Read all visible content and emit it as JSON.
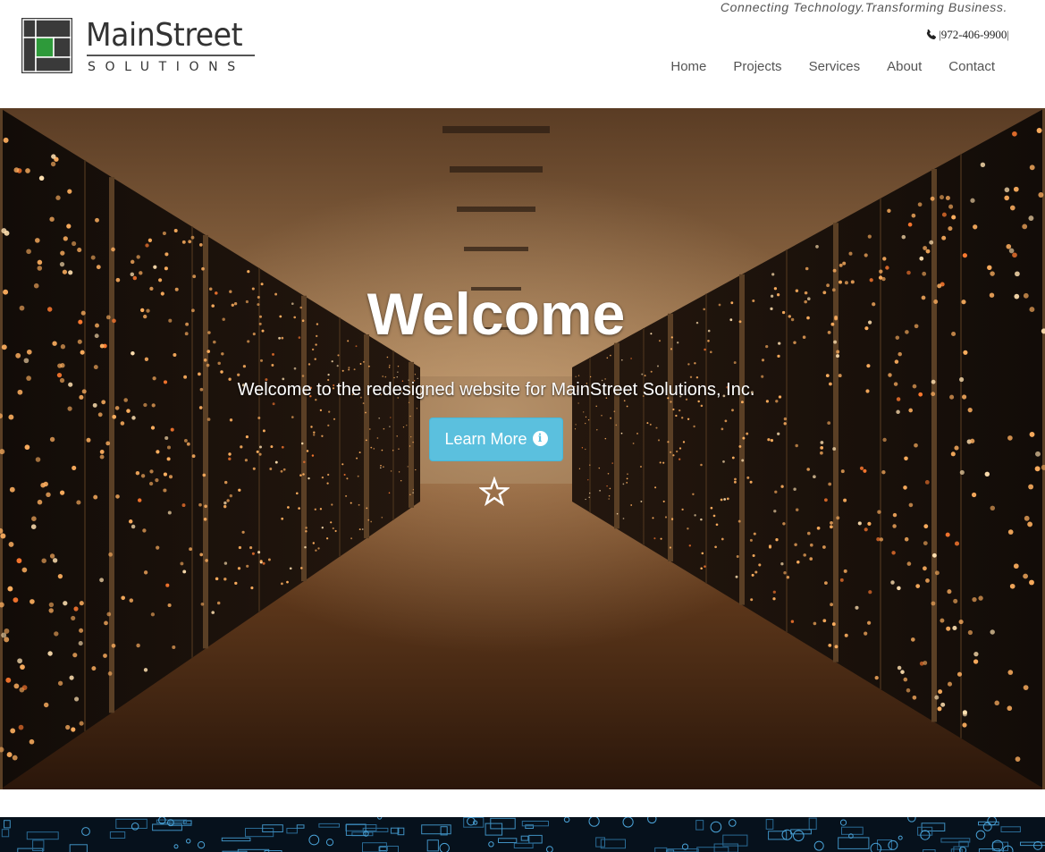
{
  "header": {
    "logo_name": "MainStreet",
    "logo_sub": "SOLUTIONS",
    "tagline": "Connecting Technology.Transforming Business.",
    "phone": "972-406-9900",
    "phone_prefix": "|",
    "phone_suffix": "|"
  },
  "nav": {
    "items": [
      {
        "label": "Home"
      },
      {
        "label": "Projects"
      },
      {
        "label": "Services"
      },
      {
        "label": "About"
      },
      {
        "label": "Contact"
      }
    ]
  },
  "hero": {
    "title": "Welcome",
    "subtitle": "Welcome to the redesigned website for MainStreet Solutions, Inc.",
    "button_label": "Learn More",
    "button_icon": "info-icon",
    "star_icon": "star-outline-icon"
  },
  "colors": {
    "logo_green": "#2e9a3a",
    "logo_dark": "#3a3a3a",
    "button": "#5bc0de",
    "text_dark": "#555555"
  }
}
